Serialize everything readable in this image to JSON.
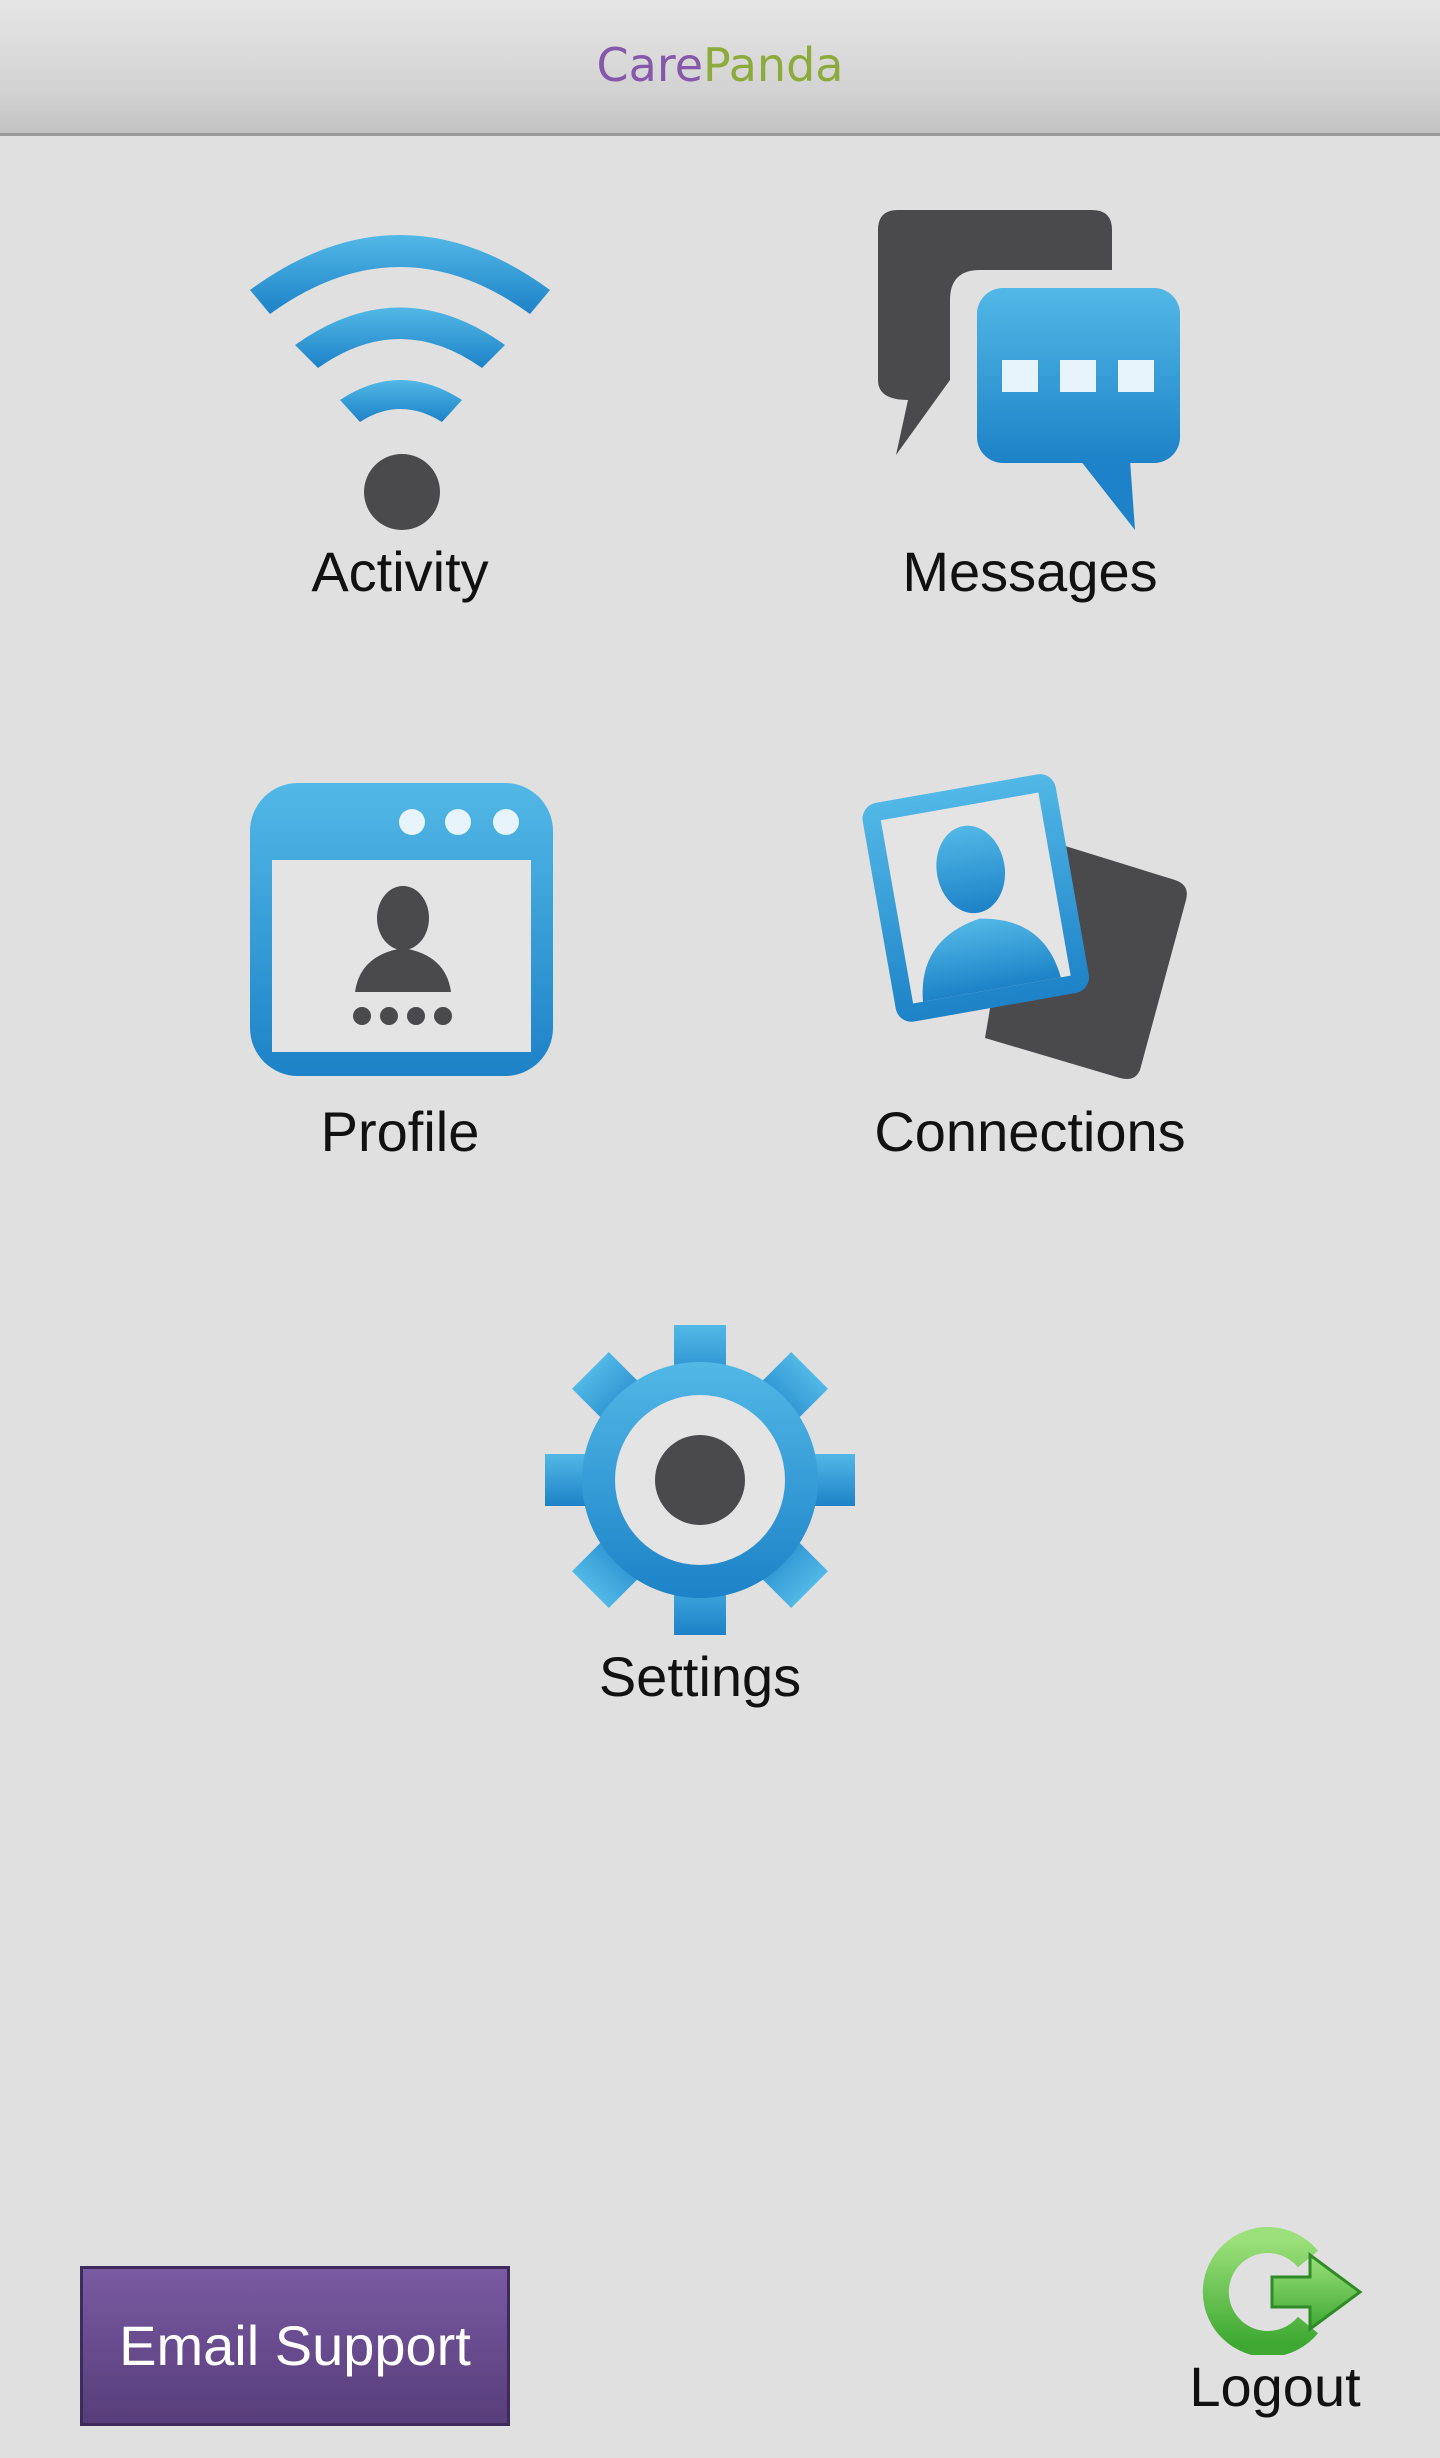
{
  "header": {
    "logo_part1": "Care",
    "logo_part2": "Panda"
  },
  "tiles": [
    {
      "label": "Activity",
      "icon": "wifi-icon"
    },
    {
      "label": "Messages",
      "icon": "chat-bubbles-icon"
    },
    {
      "label": "Profile",
      "icon": "profile-window-icon"
    },
    {
      "label": "Connections",
      "icon": "contact-cards-icon"
    },
    {
      "label": "Settings",
      "icon": "gear-icon"
    }
  ],
  "footer": {
    "email_support_label": "Email Support",
    "logout_label": "Logout",
    "logout_icon": "logout-arrow-icon"
  },
  "colors": {
    "background": "#e0e0e0",
    "icon_blue": "#2f9ad8",
    "icon_dark": "#4a4a4c",
    "brand_purple": "#8558aa",
    "brand_green": "#8cab3c",
    "button_purple": "#664a8c"
  }
}
